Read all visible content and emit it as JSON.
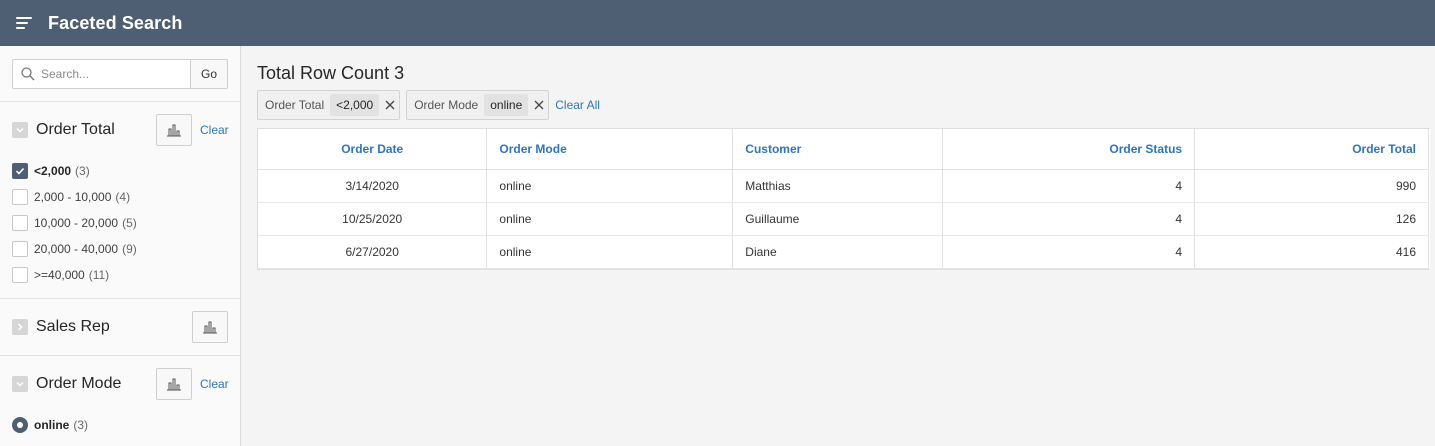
{
  "header": {
    "title": "Faceted Search"
  },
  "search": {
    "placeholder": "Search...",
    "go_label": "Go"
  },
  "facets": {
    "order_total": {
      "title": "Order Total",
      "clear_label": "Clear",
      "items": [
        {
          "label": "<2,000",
          "count": "(3)",
          "checked": true
        },
        {
          "label": "2,000 - 10,000",
          "count": "(4)",
          "checked": false
        },
        {
          "label": "10,000 - 20,000",
          "count": "(5)",
          "checked": false
        },
        {
          "label": "20,000 - 40,000",
          "count": "(9)",
          "checked": false
        },
        {
          "label": ">=40,000",
          "count": "(11)",
          "checked": false
        }
      ]
    },
    "sales_rep": {
      "title": "Sales Rep"
    },
    "order_mode": {
      "title": "Order Mode",
      "clear_label": "Clear",
      "items": [
        {
          "label": "online",
          "count": "(3)",
          "selected": true
        }
      ]
    }
  },
  "results": {
    "row_count": "Total Row Count 3",
    "chips": [
      {
        "name": "Order Total",
        "value": "<2,000"
      },
      {
        "name": "Order Mode",
        "value": "online"
      }
    ],
    "clear_all_label": "Clear All",
    "columns": [
      "Order Date",
      "Order Mode",
      "Customer",
      "Order Status",
      "Order Total"
    ],
    "rows": [
      [
        "3/14/2020",
        "online",
        "Matthias",
        "4",
        "990"
      ],
      [
        "10/25/2020",
        "online",
        "Guillaume",
        "4",
        "126"
      ],
      [
        "6/27/2020",
        "online",
        "Diane",
        "4",
        "416"
      ]
    ]
  },
  "colors": {
    "header_bg": "#4f5f73",
    "link": "#2f74c0",
    "check": "#4f5f73"
  }
}
